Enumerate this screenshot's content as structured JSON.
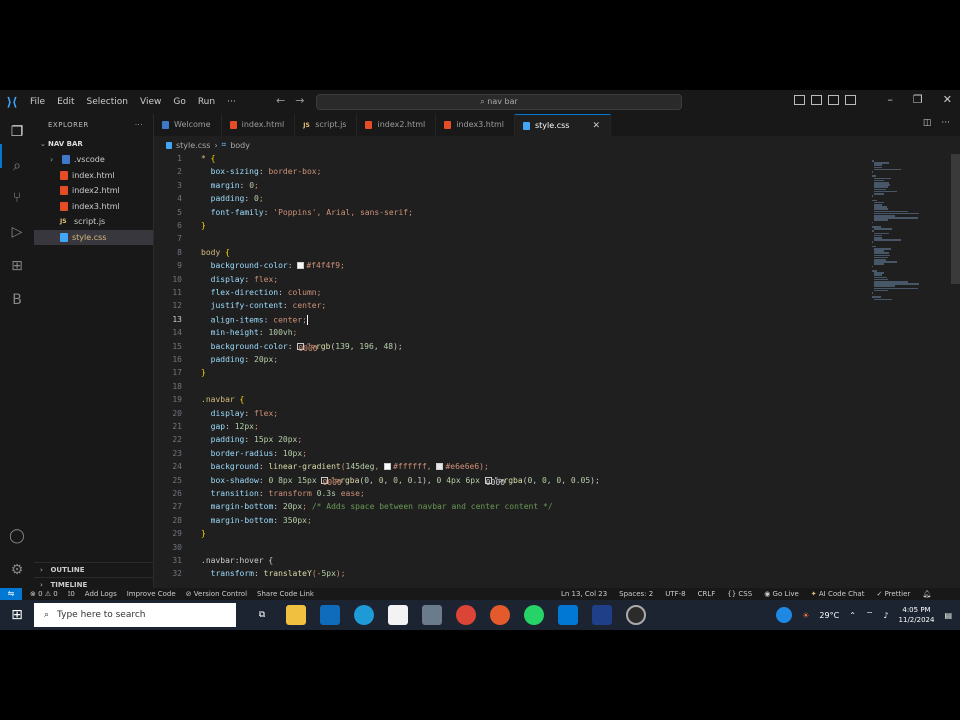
{
  "menu": [
    "File",
    "Edit",
    "Selection",
    "View",
    "Go",
    "Run",
    "···"
  ],
  "search": {
    "text": "nav bar"
  },
  "explorer": {
    "title": "EXPLORER",
    "folder": "NAV BAR",
    "items": [
      ".vscode",
      "index.html",
      "index2.html",
      "index3.html",
      "script.js",
      "style.css"
    ],
    "outline": "OUTLINE",
    "timeline": "TIMELINE"
  },
  "tabs": [
    "Welcome",
    "index.html",
    "script.js",
    "index2.html",
    "index3.html",
    "style.css"
  ],
  "breadcrumb": {
    "file": "style.css",
    "symbol": "body"
  },
  "code_lines": [
    {
      "n": "1",
      "t": "* {"
    },
    {
      "n": "2",
      "t": "  box-sizing: border-box;"
    },
    {
      "n": "3",
      "t": "  margin: 0;"
    },
    {
      "n": "4",
      "t": "  padding: 0;"
    },
    {
      "n": "5",
      "t": "  font-family: 'Poppins', Arial, sans-serif;"
    },
    {
      "n": "6",
      "t": "}"
    },
    {
      "n": "7",
      "t": ""
    },
    {
      "n": "8",
      "t": "body {"
    },
    {
      "n": "9",
      "t": "  background-color: #f4f4f9;"
    },
    {
      "n": "10",
      "t": "  display: flex;"
    },
    {
      "n": "11",
      "t": "  flex-direction: column;"
    },
    {
      "n": "12",
      "t": "  justify-content: center;"
    },
    {
      "n": "13",
      "t": "  align-items: center;"
    },
    {
      "n": "14",
      "t": "  min-height: 100vh;"
    },
    {
      "n": "15",
      "t": "  background-color: rgb(139, 196, 48);"
    },
    {
      "n": "16",
      "t": "  padding: 20px;"
    },
    {
      "n": "17",
      "t": "}"
    },
    {
      "n": "18",
      "t": ""
    },
    {
      "n": "19",
      "t": ".navbar {"
    },
    {
      "n": "20",
      "t": "  display: flex;"
    },
    {
      "n": "21",
      "t": "  gap: 12px;"
    },
    {
      "n": "22",
      "t": "  padding: 15px 20px;"
    },
    {
      "n": "23",
      "t": "  border-radius: 10px;"
    },
    {
      "n": "24",
      "t": "  background: linear-gradient(145deg, #ffffff, #e6e6e6);"
    },
    {
      "n": "25",
      "t": "  box-shadow: 0 8px 15px rgba(0, 0, 0, 0.1), 0 4px 6px rgba(0, 0, 0, 0.05);"
    },
    {
      "n": "26",
      "t": "  transition: transform 0.3s ease;"
    },
    {
      "n": "27",
      "t": "  margin-bottom: 20px; /* Adds space between navbar and center content */"
    },
    {
      "n": "28",
      "t": "  margin-bottom: 350px;"
    },
    {
      "n": "29",
      "t": "}"
    },
    {
      "n": "30",
      "t": ""
    },
    {
      "n": "31",
      "t": ".navbar:hover {"
    },
    {
      "n": "32",
      "t": "  transform: translateY(-5px);"
    }
  ],
  "status": {
    "errors": "⊗ 0 ⚠ 0",
    "ports": "⟟0",
    "items_left": [
      "Add Logs",
      "Improve Code",
      "Version Control",
      "Share Code Link"
    ],
    "position": "Ln 13, Col 23",
    "spaces": "Spaces: 2",
    "encoding": "UTF-8",
    "eol": "CRLF",
    "language": "CSS",
    "golive": "Go Live",
    "chat": "AI Code Chat",
    "prettier": "Prettier"
  },
  "taskbar": {
    "search_placeholder": "Type here to search",
    "weather": "29°C",
    "time": "4:05 PM",
    "date": "11/2/2024"
  },
  "colors": {
    "accent": "#0078d4",
    "editor_bg": "#1f1f1f",
    "swatch1": "#f4f4f9",
    "swatch2": "#8bc430",
    "swatch3": "#ffffff",
    "swatch4": "#e6e6e6"
  }
}
